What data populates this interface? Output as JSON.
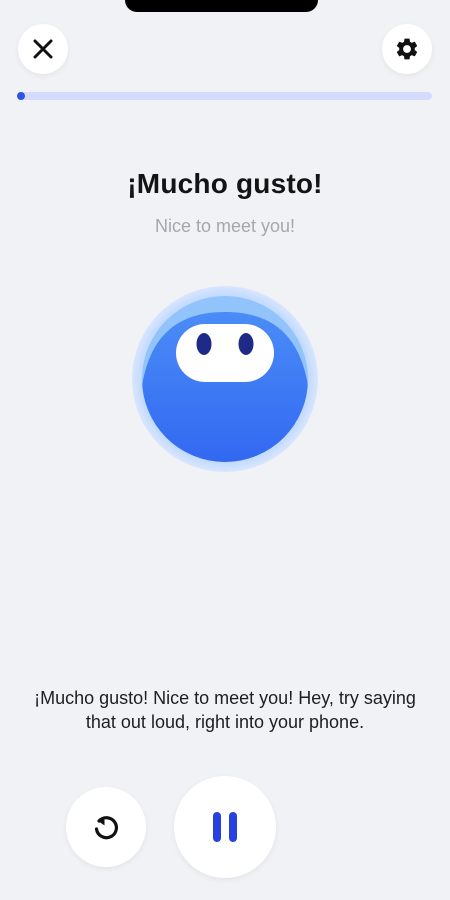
{
  "header": {
    "close_icon": "close-icon",
    "settings_icon": "gear-icon"
  },
  "progress": {
    "fraction": 0.01,
    "fill_color": "#2e52e6",
    "track_color": "#d3dcfb"
  },
  "lesson": {
    "phrase": "¡Mucho gusto!",
    "translation": "Nice to meet you!"
  },
  "avatar": {
    "icon": "blob-character-avatar",
    "color": "#3f7df5"
  },
  "caption": {
    "text": "¡Mucho gusto! Nice to meet you! Hey, try saying that out loud, right into your phone."
  },
  "controls": {
    "replay_icon": "replay-icon",
    "pause_icon": "pause-icon",
    "accent": "#2741e0"
  }
}
